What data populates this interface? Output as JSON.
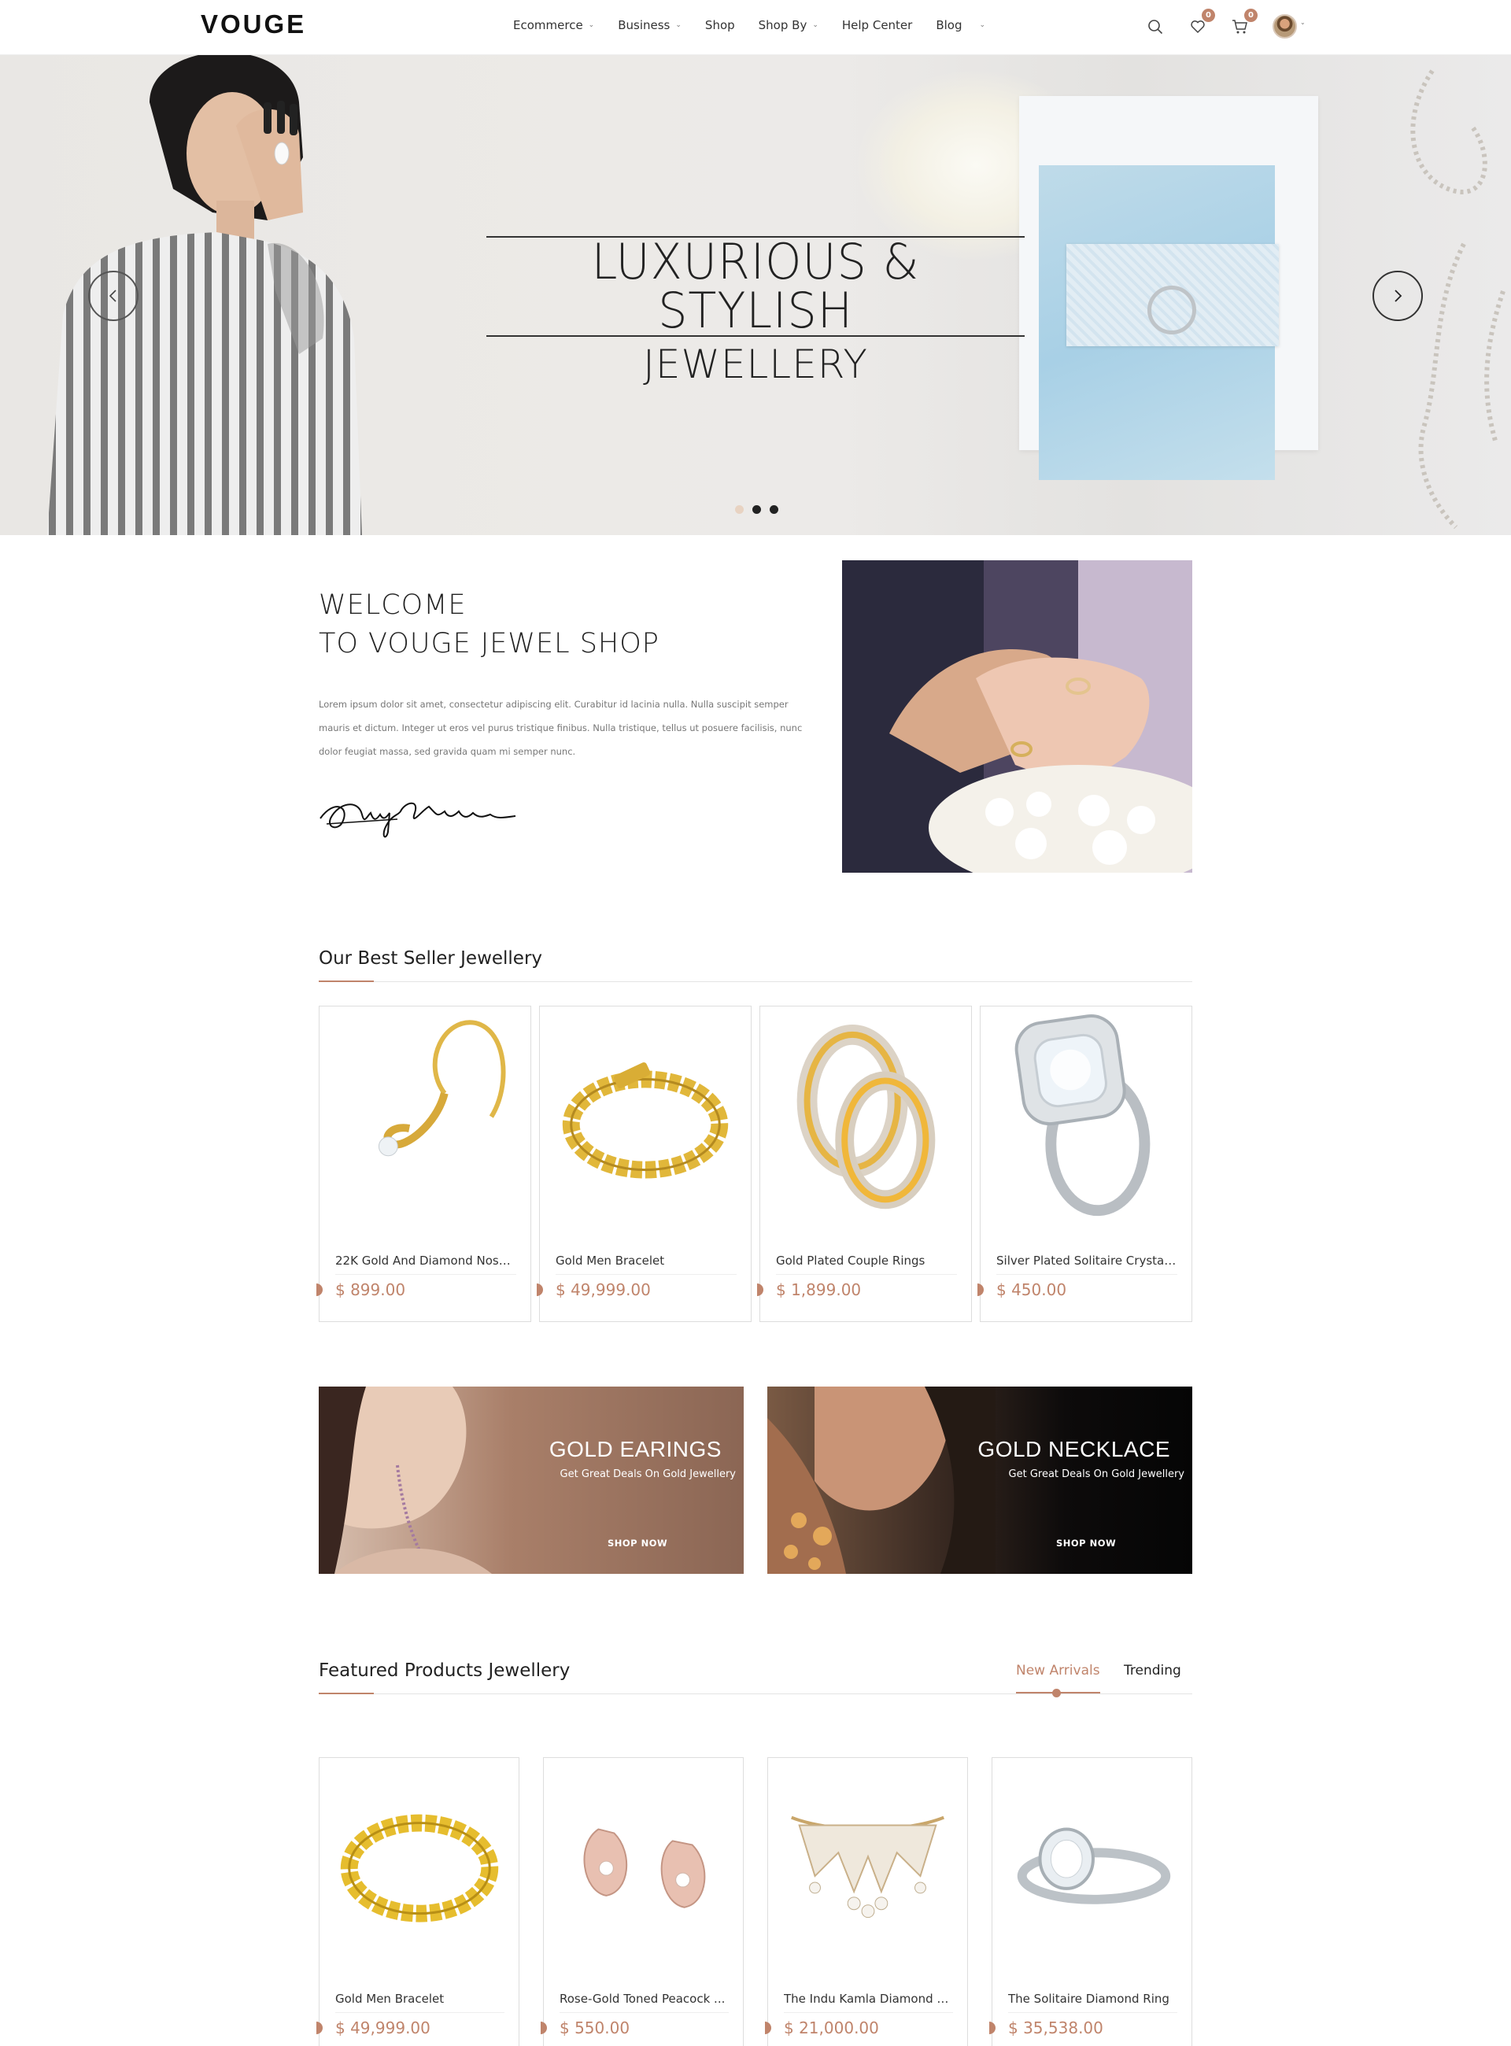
{
  "header": {
    "logo": "VOUGE",
    "nav": [
      {
        "label": "Ecommerce",
        "has_dropdown": true
      },
      {
        "label": "Business",
        "has_dropdown": true
      },
      {
        "label": "Shop",
        "has_dropdown": false
      },
      {
        "label": "Shop By",
        "has_dropdown": true
      },
      {
        "label": "Help Center",
        "has_dropdown": false
      },
      {
        "label": "Blog",
        "has_dropdown": true
      }
    ],
    "icons": {
      "search": "search-icon",
      "wishlist": "heart-icon",
      "cart": "cart-icon",
      "profile": "avatar"
    },
    "wishlist_count": "0",
    "cart_count": "0"
  },
  "hero": {
    "title_line1": "LUXURIOUS & STYLISH",
    "title_line2": "JEWELLERY",
    "slides": 3,
    "active_slide": 1
  },
  "welcome": {
    "title_line1": "WELCOME",
    "title_line2": "TO VOUGE JEWEL SHOP",
    "text": "Lorem ipsum dolor sit amet, consectetur adipiscing elit. Curabitur id lacinia nulla. Nulla suscipit semper mauris et dictum. Integer ut eros vel purus tristique finibus. Nulla tristique, tellus ut posuere facilisis, nunc dolor feugiat massa, sed gravida quam mi semper nunc."
  },
  "best_seller": {
    "title": "Our Best Seller Jewellery",
    "products": [
      {
        "name": "22K Gold And Diamond Nose...",
        "price": "$ 899.00",
        "image": "gold-nose-pin"
      },
      {
        "name": "Gold Men Bracelet",
        "price": "$ 49,999.00",
        "image": "gold-bracelet"
      },
      {
        "name": "Gold Plated Couple Rings",
        "price": "$ 1,899.00",
        "image": "couple-rings"
      },
      {
        "name": "Silver Plated Solitaire Crystal...",
        "price": "$ 450.00",
        "image": "solitaire-ring"
      }
    ]
  },
  "promos": [
    {
      "title": "GOLD EARINGS",
      "subtitle": "Get Great Deals On Gold Jewellery",
      "button": "SHOP NOW"
    },
    {
      "title": "GOLD NECKLACE",
      "subtitle": "Get Great Deals On Gold Jewellery",
      "button": "SHOP NOW"
    }
  ],
  "featured": {
    "title": "Featured Products Jewellery",
    "tabs": [
      {
        "label": "New Arrivals",
        "active": true
      },
      {
        "label": "Trending",
        "active": false
      }
    ],
    "products": [
      {
        "name": "Gold Men Bracelet",
        "price": "$ 49,999.00",
        "image": "gold-bracelet"
      },
      {
        "name": "Rose-Gold Toned Peacock ...",
        "price": "$ 550.00",
        "image": "peacock-earrings"
      },
      {
        "name": "The Indu Kamla Diamond N...",
        "price": "$ 21,000.00",
        "image": "diamond-necklace"
      },
      {
        "name": "The Solitaire Diamond Ring",
        "price": "$ 35,538.00",
        "image": "diamond-ring"
      }
    ]
  },
  "colors": {
    "accent": "#c0846b",
    "text": "#222222",
    "muted": "#777777"
  }
}
